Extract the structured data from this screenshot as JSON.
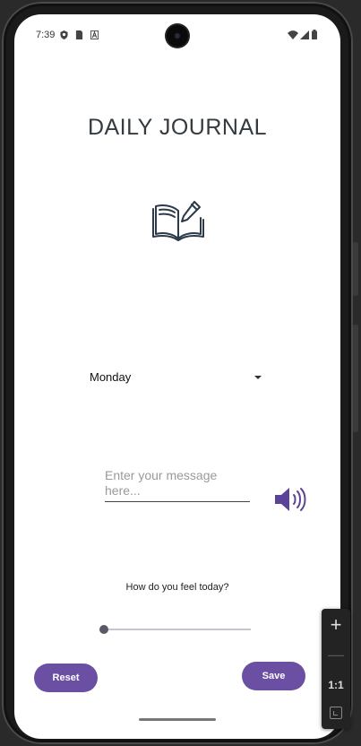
{
  "status_bar": {
    "time": "7:39",
    "icons": [
      "shield-icon",
      "sim-icon",
      "font-icon",
      "wifi-icon",
      "signal-icon",
      "battery-icon"
    ]
  },
  "app": {
    "title": "DAILY JOURNAL",
    "icon": "open-book-pencil-icon",
    "day_dropdown": {
      "selected": "Monday"
    },
    "message_input": {
      "value": "",
      "placeholder": "Enter your message here..."
    },
    "speaker_icon": "speaker-icon",
    "feel_label": "How do you feel today?",
    "mood_slider": {
      "value": 0
    },
    "reset_label": "Reset",
    "save_label": "Save"
  },
  "zoom_toolbar": {
    "plus": "+",
    "minus": "—",
    "ratio_label": "1:1"
  },
  "colors": {
    "accent": "#6a4fa3",
    "speaker": "#5b4397",
    "icon_ink": "#2d3a4a"
  }
}
